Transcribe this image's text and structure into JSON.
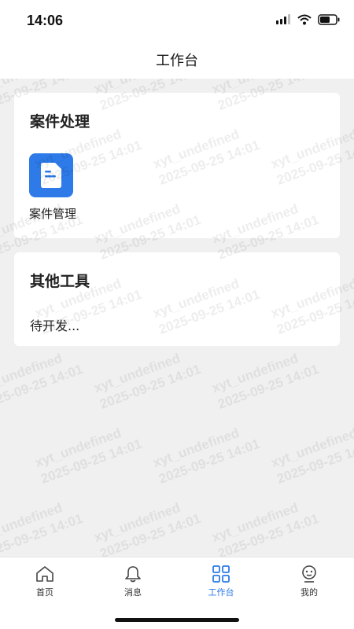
{
  "status_bar": {
    "time": "14:06"
  },
  "header": {
    "title": "工作台"
  },
  "cards": [
    {
      "title": "案件处理",
      "tools": [
        {
          "label": "案件管理",
          "icon": "document-icon"
        }
      ]
    },
    {
      "title": "其他工具",
      "placeholder_text": "待开发..."
    }
  ],
  "watermark": {
    "user": "xyt_undefined",
    "timestamp": "2025-09-25 14:01"
  },
  "tabs": [
    {
      "label": "首页",
      "icon": "home-icon",
      "active": false
    },
    {
      "label": "消息",
      "icon": "bell-icon",
      "active": false
    },
    {
      "label": "工作台",
      "icon": "grid-icon",
      "active": true
    },
    {
      "label": "我的",
      "icon": "profile-icon",
      "active": false
    }
  ],
  "colors": {
    "accent": "#2d7ae8",
    "background": "#f0f0f0",
    "card": "#ffffff"
  }
}
